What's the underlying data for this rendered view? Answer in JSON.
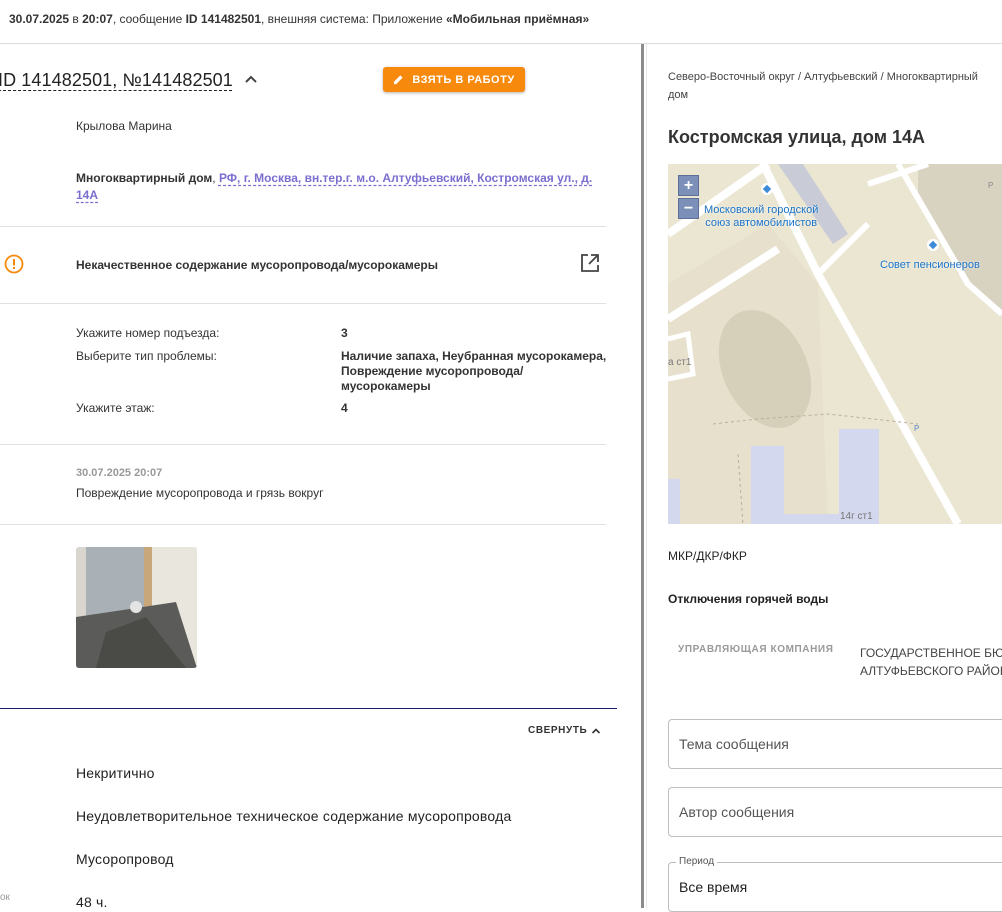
{
  "topbar": {
    "date": "30.07.2025",
    "in": " в ",
    "time": "20:07",
    "mid": ", сообщение ",
    "id": "ID 141482501",
    "ext": ", внешняя система: Приложение ",
    "app": "«Мобильная приёмная»"
  },
  "ticket": {
    "title": "ID 141482501, №141482501",
    "take_button": "ВЗЯТЬ В РАБОТУ",
    "author": "Крылова Марина",
    "address_type": "Многоквартирный дом",
    "address_link_1": "РФ, г. Москва, вн.тер.г. м.о. Алтуфьевский, Костромская ул., д.",
    "address_link_2": "14А",
    "problem": "Некачественное содержание мусоропровода/мусорокамеры",
    "fields": [
      {
        "label": "Укажите номер подъезда:",
        "value": "3"
      },
      {
        "label": "Выберите тип проблемы:",
        "value1": "Наличие запаха, Неубранная мусорокамера,",
        "value2": "Повреждение мусоропровода/",
        "value3": "мусорокамеры"
      },
      {
        "label": "Укажите этаж:",
        "value": "4"
      }
    ],
    "comment_date": "30.07.2025 20:07",
    "comment_text": "Повреждение мусоропровода и грязь вокруг",
    "collapse": "СВЕРНУТЬ",
    "info": [
      "Некритично",
      "Неудовлетворительное техническое содержание мусоропровода",
      "Мусоропровод",
      "48 ч."
    ],
    "side_label": "ок"
  },
  "right": {
    "breadcrumb_1": "Северо-Восточный округ / Алтуфьевский / Многоквартирный",
    "breadcrumb_2": "дом",
    "address": "Костромская улица, дом 14А",
    "map": {
      "zoom_in": "+",
      "zoom_out": "−",
      "poi_1a": "Московский городской",
      "poi_1b": "союз автомобилистов",
      "poi_2": "Совет пенсионеров",
      "bldg_1": "а ст1",
      "bldg_2": "14г ст1",
      "parking": "P"
    },
    "section_1": "МКР/ДКР/ФКР",
    "section_2": "Отключения горячей воды",
    "company_label": "УПРАВЛЯЮЩАЯ КОМПАНИЯ",
    "company_value_1": "ГОСУДАРСТВЕННОЕ БЮД",
    "company_value_2": "АЛТУФЬЕВСКОГО РАЙОН",
    "input_topic": "Тема сообщения",
    "input_author": "Автор сообщения",
    "period_label": "Период",
    "period_value": "Все время"
  },
  "colors": {
    "accent": "#f7890c",
    "link": "#7a6fcf",
    "map_bg": "#ebe5d0",
    "map_poi": "#1a73c8"
  }
}
